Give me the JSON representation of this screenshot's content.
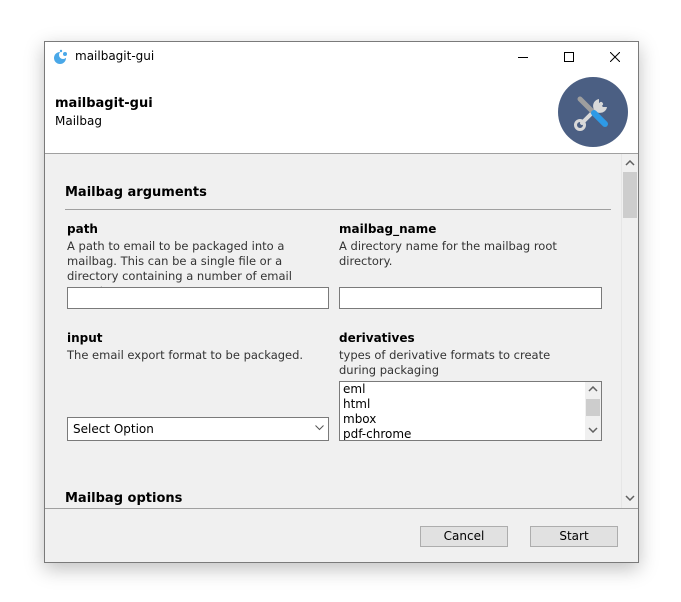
{
  "window": {
    "title": "mailbagit-gui",
    "controls": {
      "minimize": "minimize-icon",
      "maximize": "maximize-icon",
      "close": "close-icon"
    }
  },
  "header": {
    "title": "mailbagit-gui",
    "subtitle": "Mailbag",
    "logo_icon": "tools-icon",
    "logo_color": "#4b5f83"
  },
  "sections": {
    "arguments": {
      "title": "Mailbag arguments",
      "fields": {
        "path": {
          "label": "path",
          "description": "A path to email to be packaged into a mailbag. This can be a single file or a directory containing a number of email exports.",
          "value": ""
        },
        "mailbag_name": {
          "label": "mailbag_name",
          "description": "A directory name for the mailbag root directory.",
          "value": ""
        },
        "input": {
          "label": "input",
          "description": "The email export format to be packaged.",
          "selected": "Select Option"
        },
        "derivatives": {
          "label": "derivatives",
          "description": "types of derivative formats to create during packaging",
          "options": [
            "eml",
            "html",
            "mbox",
            "pdf-chrome"
          ]
        }
      }
    },
    "options": {
      "title": "Mailbag options"
    }
  },
  "footer": {
    "cancel_label": "Cancel",
    "start_label": "Start"
  }
}
